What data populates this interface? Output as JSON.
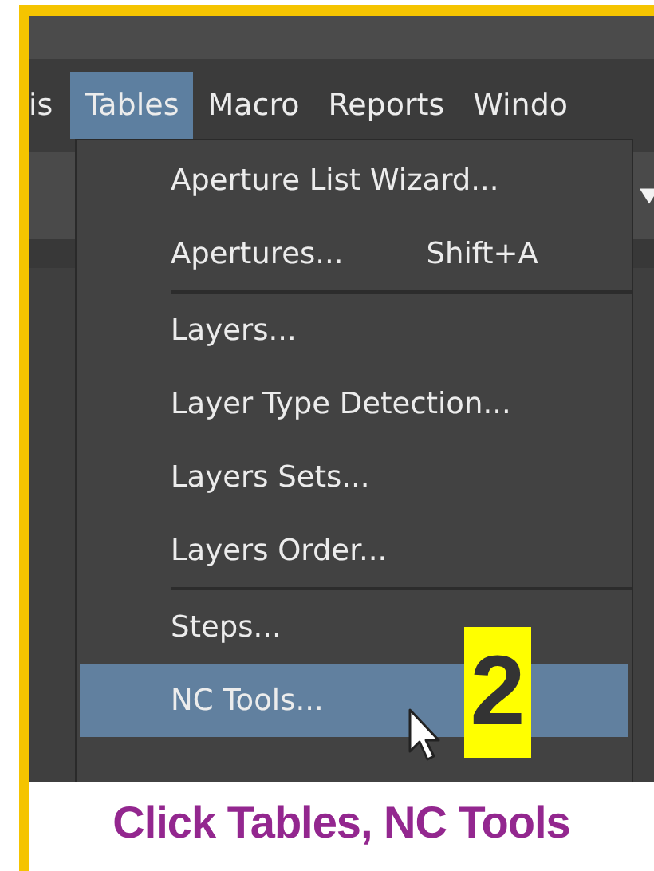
{
  "menu_bar": [
    {
      "label": "is",
      "selected": false
    },
    {
      "label": "Tables",
      "selected": true
    },
    {
      "label": "Macro",
      "selected": false
    },
    {
      "label": "Reports",
      "selected": false
    },
    {
      "label": "Windo",
      "selected": false
    }
  ],
  "menu": [
    {
      "kind": "item",
      "label": "Aperture List Wizard...",
      "selected": false
    },
    {
      "kind": "item",
      "label": "Apertures...",
      "shortcut": "Shift+A",
      "selected": false
    },
    {
      "kind": "separator"
    },
    {
      "kind": "item",
      "label": "Layers...",
      "selected": false
    },
    {
      "kind": "item",
      "label": "Layer Type Detection...",
      "selected": false
    },
    {
      "kind": "item",
      "label": "Layers Sets...",
      "selected": false
    },
    {
      "kind": "item",
      "label": "Layers Order...",
      "selected": false
    },
    {
      "kind": "separator"
    },
    {
      "kind": "item",
      "label": "Steps...",
      "selected": false
    },
    {
      "kind": "item",
      "label": "NC Tools...",
      "selected": true
    }
  ],
  "step_badge": "2",
  "caption": "Click Tables, NC Tools"
}
